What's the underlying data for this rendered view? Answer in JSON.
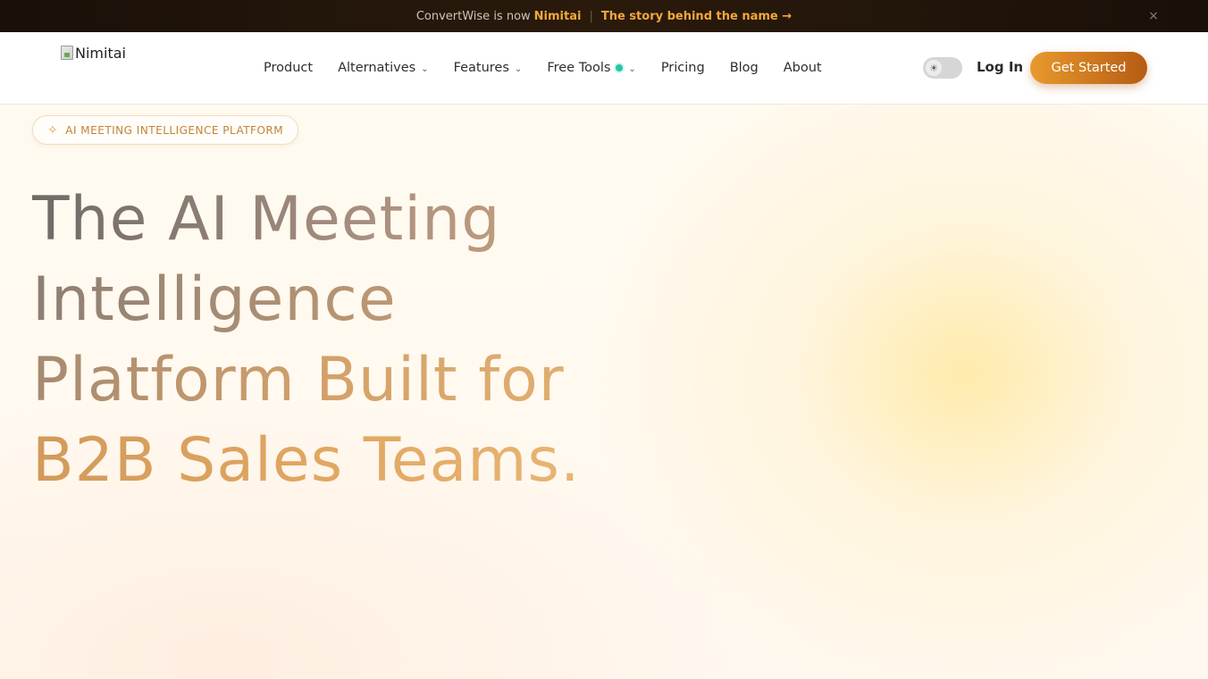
{
  "announcement": {
    "prefix": "ConvertWise is now",
    "brand": "Nimitai",
    "separator": "|",
    "link_label": "The story behind the name →",
    "close_icon": "×"
  },
  "nav": {
    "logo_alt": "Nimitai",
    "items": [
      {
        "label": "Product",
        "dropdown": false
      },
      {
        "label": "Alternatives",
        "dropdown": true
      },
      {
        "label": "Features",
        "dropdown": true
      },
      {
        "label": "Free Tools",
        "dropdown": true,
        "badge_color": "#22c7a9"
      },
      {
        "label": "Pricing",
        "dropdown": false
      },
      {
        "label": "Blog",
        "dropdown": false
      },
      {
        "label": "About",
        "dropdown": false
      }
    ],
    "chevron": "⌄",
    "theme_toggle_icon": "☀",
    "login_label": "Log In",
    "cta_label": "Get Started"
  },
  "hero": {
    "badge_icon": "✧",
    "badge_label": "AI MEETING INTELLIGENCE PLATFORM",
    "headline_lines": [
      "The AI Meeting",
      "Intelligence",
      "Platform Built for",
      "B2B Sales Teams."
    ]
  },
  "colors": {
    "accent": "#e89a2c",
    "accent_dark": "#b65b14",
    "announcement_bg": "#1a1008",
    "badge_dot": "#22c7a9"
  }
}
